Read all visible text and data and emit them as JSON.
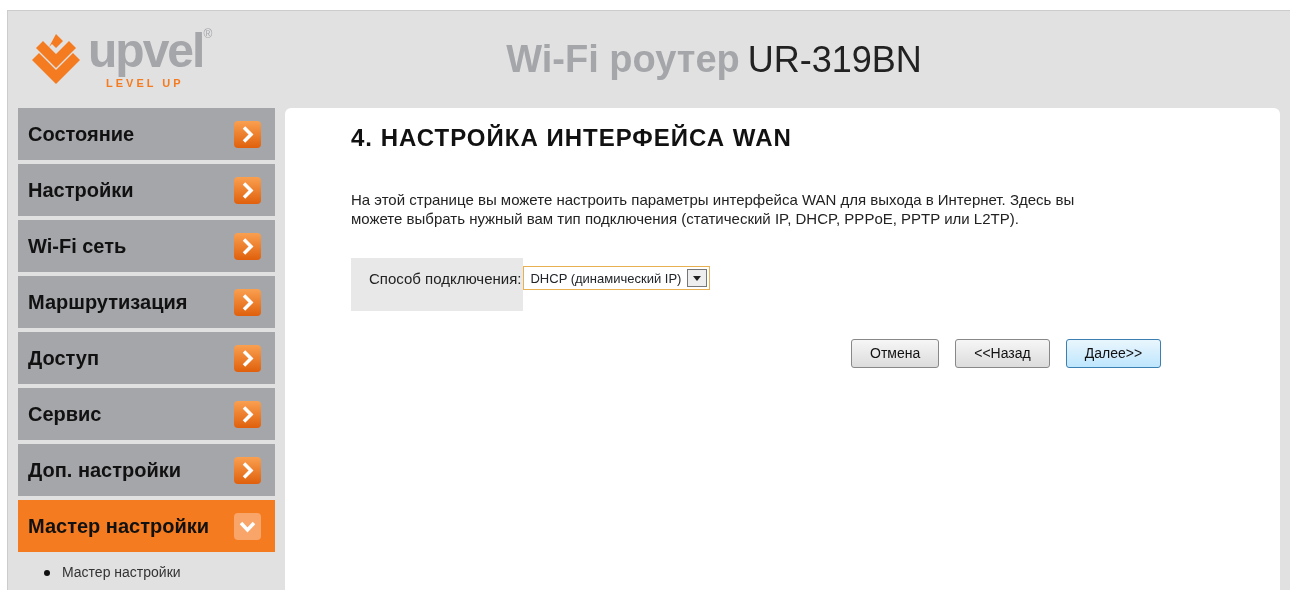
{
  "logo": {
    "brand": "upvel",
    "registered": "®",
    "tagline": "LEVEL UP"
  },
  "header": {
    "product": "Wi-Fi роутер",
    "model": "UR-319BN"
  },
  "menu": [
    {
      "label": "Состояние",
      "selected": false,
      "expanded": false
    },
    {
      "label": "Настройки",
      "selected": false,
      "expanded": false
    },
    {
      "label": "Wi-Fi сеть",
      "selected": false,
      "expanded": false
    },
    {
      "label": "Маршрутизация",
      "selected": false,
      "expanded": false
    },
    {
      "label": "Доступ",
      "selected": false,
      "expanded": false
    },
    {
      "label": "Сервис",
      "selected": false,
      "expanded": false
    },
    {
      "label": "Доп. настройки",
      "selected": false,
      "expanded": false
    },
    {
      "label": "Мастер настройки",
      "selected": true,
      "expanded": true,
      "children": [
        {
          "label": "Мастер настройки"
        }
      ]
    }
  ],
  "page": {
    "title": "4. НАСТРОЙКА ИНТЕРФЕЙСА WAN",
    "description": "На этой странице вы можете настроить параметры интерфейса WAN для выхода в Интернет. Здесь вы можете выбрать нужный вам тип подключения (статический IP, DHCP, PPPoE, PPTP или L2TP).",
    "field": {
      "label": "Способ подключения:",
      "value": "DHCP (динамический IP)"
    },
    "buttons": [
      {
        "label": "Отмена",
        "kind": "plain"
      },
      {
        "label": "<<Назад",
        "kind": "plain"
      },
      {
        "label": "Далее>>",
        "kind": "default"
      }
    ]
  }
}
